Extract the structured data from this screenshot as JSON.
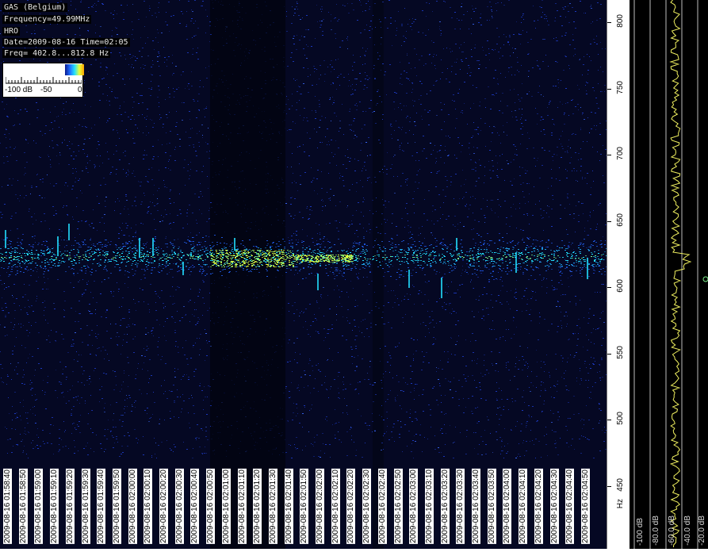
{
  "info": {
    "station": "GAS (Belgium)",
    "frequency": "Frequency=49.99MHz",
    "mode": "HRO",
    "datetime": "Date=2009-08-16 Time=02:05",
    "freq_range": "Freq= 402.8...812.8 Hz"
  },
  "intensity_scale": {
    "label_min": "-100 dB",
    "label_mid": "-50",
    "label_max": "0"
  },
  "frequency_axis": {
    "ticks": [
      "800",
      "750",
      "700",
      "650",
      "600",
      "550",
      "500",
      "450"
    ],
    "unit": "Hz"
  },
  "time_axis": {
    "labels": [
      "2009-08-16 01:58:40",
      "2009-08-16 01:58:50",
      "2009-08-16 01:59:00",
      "2009-08-16 01:59:10",
      "2009-08-16 01:59:20",
      "2009-08-16 01:59:30",
      "2009-08-16 01:59:40",
      "2009-08-16 01:59:50",
      "2009-08-16 02:00:00",
      "2009-08-16 02:00:10",
      "2009-08-16 02:00:20",
      "2009-08-16 02:00:30",
      "2009-08-16 02:00:40",
      "2009-08-16 02:00:50",
      "2009-08-16 02:01:00",
      "2009-08-16 02:01:10",
      "2009-08-16 02:01:20",
      "2009-08-16 02:01:30",
      "2009-08-16 02:01:40",
      "2009-08-16 02:01:50",
      "2009-08-16 02:02:00",
      "2009-08-16 02:02:10",
      "2009-08-16 02:02:20",
      "2009-08-16 02:02:30",
      "2009-08-16 02:02:40",
      "2009-08-16 02:02:50",
      "2009-08-16 02:03:00",
      "2009-08-16 02:03:10",
      "2009-08-16 02:03:20",
      "2009-08-16 02:03:30",
      "2009-08-16 02:03:40",
      "2009-08-16 02:03:50",
      "2009-08-16 02:04:00",
      "2009-08-16 02:04:10",
      "2009-08-16 02:04:20",
      "2009-08-16 02:04:30",
      "2009-08-16 02:04:40",
      "2009-08-16 02:04:50"
    ]
  },
  "spectrum_panel": {
    "db_labels": [
      "-100 dB",
      "-80.0 dB",
      "-60.0 dB",
      "-40.0 dB",
      "-20.0 dB"
    ]
  },
  "colors": {
    "background": "#050823",
    "noise": "#1e3cc8",
    "carrier": "#22e0ff",
    "peak": "#e8ff3a",
    "trace": "#f0f060"
  }
}
